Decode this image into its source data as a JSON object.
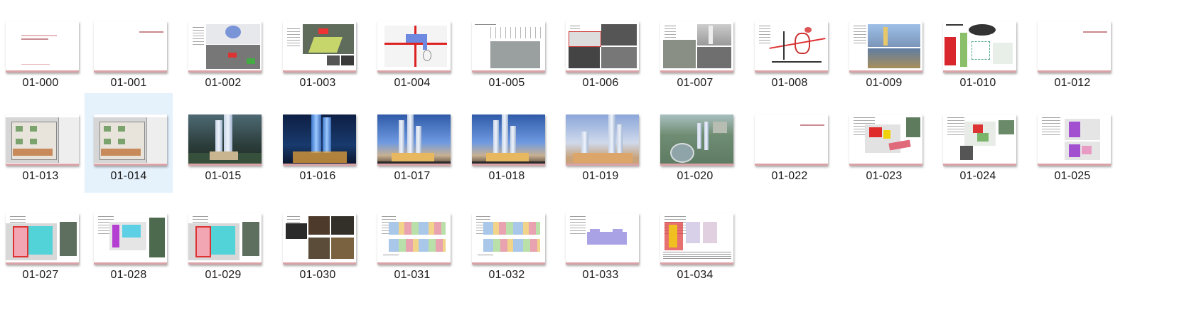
{
  "folder": {
    "items": [
      {
        "label": "01-000",
        "kind": "cover-left"
      },
      {
        "label": "01-001",
        "kind": "cover-right"
      },
      {
        "label": "01-002",
        "kind": "map-analysis"
      },
      {
        "label": "01-003",
        "kind": "aerial-green"
      },
      {
        "label": "01-004",
        "kind": "road-diagram"
      },
      {
        "label": "01-005",
        "kind": "table-map"
      },
      {
        "label": "01-006",
        "kind": "bw-photos"
      },
      {
        "label": "01-007",
        "kind": "tower-photos"
      },
      {
        "label": "01-008",
        "kind": "route-map"
      },
      {
        "label": "01-009",
        "kind": "city-photos"
      },
      {
        "label": "01-010",
        "kind": "red-diagram"
      },
      {
        "label": "01-012",
        "kind": "cover-right"
      },
      {
        "label": "01-013",
        "kind": "site-plan"
      },
      {
        "label": "01-014",
        "kind": "site-plan",
        "selected": true
      },
      {
        "label": "01-015",
        "kind": "render-day"
      },
      {
        "label": "01-016",
        "kind": "render-night-blue"
      },
      {
        "label": "01-017",
        "kind": "render-dusk"
      },
      {
        "label": "01-018",
        "kind": "render-dusk"
      },
      {
        "label": "01-019",
        "kind": "render-evening"
      },
      {
        "label": "01-020",
        "kind": "render-aerial"
      },
      {
        "label": "01-022",
        "kind": "cover-right"
      },
      {
        "label": "01-023",
        "kind": "layout-red"
      },
      {
        "label": "01-024",
        "kind": "layout-green"
      },
      {
        "label": "01-025",
        "kind": "layout-purple"
      },
      {
        "label": "01-027",
        "kind": "plan-cyan"
      },
      {
        "label": "01-028",
        "kind": "plan-magenta"
      },
      {
        "label": "01-029",
        "kind": "plan-cyan"
      },
      {
        "label": "01-030",
        "kind": "interior-photos"
      },
      {
        "label": "01-031",
        "kind": "unit-plan-color"
      },
      {
        "label": "01-032",
        "kind": "unit-plan-color"
      },
      {
        "label": "01-033",
        "kind": "unit-plan-purple"
      },
      {
        "label": "01-034",
        "kind": "tech-sheet"
      }
    ]
  },
  "colors": {
    "selection": "#e5f1fb",
    "accent_pink": "#d9a3a7",
    "text": "#1a1a1a"
  }
}
